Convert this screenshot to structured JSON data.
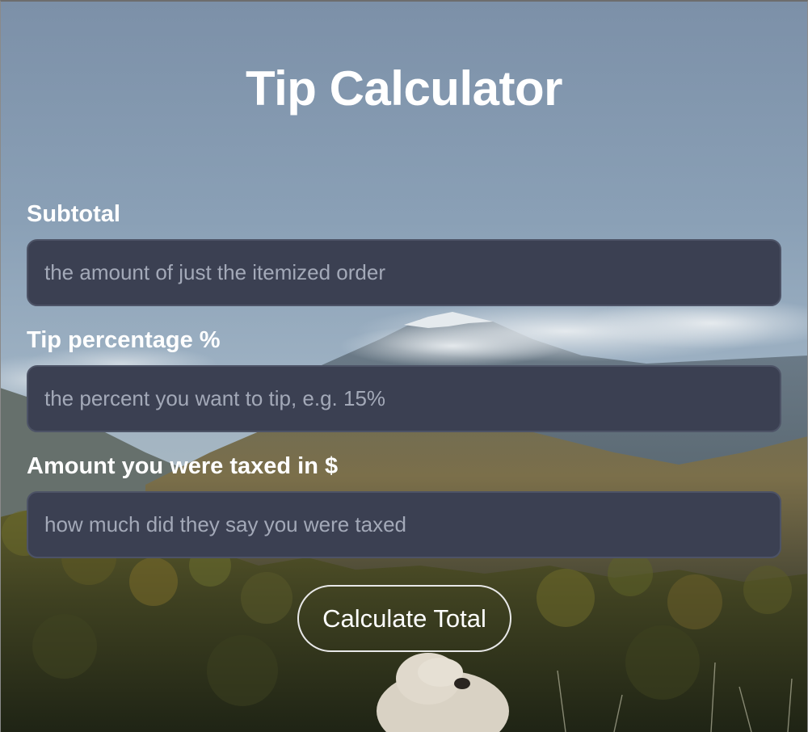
{
  "title": "Tip Calculator",
  "form": {
    "fields": [
      {
        "label": "Subtotal",
        "value": "",
        "placeholder": "the amount of just the itemized order"
      },
      {
        "label": "Tip percentage %",
        "value": "",
        "placeholder": "the percent you want to tip, e.g. 15%"
      },
      {
        "label": "Amount you were taxed in $",
        "value": "",
        "placeholder": "how much did they say you were taxed"
      }
    ],
    "submit_label": "Calculate Total"
  },
  "colors": {
    "input_background": "#3b4052",
    "input_border": "#4d5366",
    "text": "#ffffff",
    "placeholder": "#a3a9b8",
    "button_border": "#e8e8e8"
  },
  "background_image": "mountain landscape with clouds, forest and a sheep"
}
